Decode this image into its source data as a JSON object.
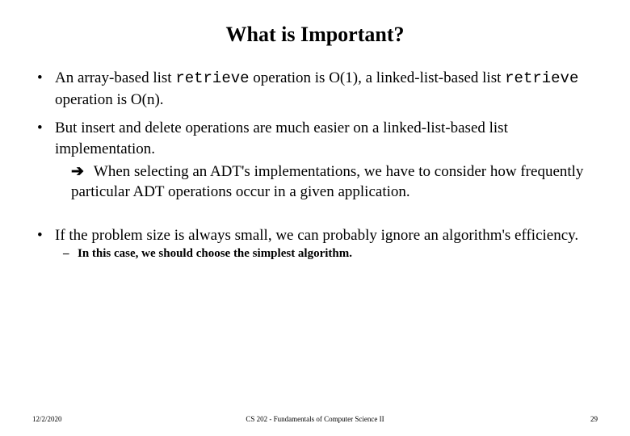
{
  "title": "What is Important?",
  "bullets": {
    "b1_pre": "An array-based list ",
    "b1_code1": "retrieve",
    "b1_mid": " operation is O(1), a linked-list-based list ",
    "b1_code2": "retrieve",
    "b1_post": " operation is O(n).",
    "b2_line1": "But insert and delete operations are much easier on a linked-list-based list implementation.",
    "b2_arrow_text": "When selecting an ADT's implementations, we have to consider how frequently particular ADT operations occur in a given application.",
    "b3": "If the problem size is always small, we can probably ignore an algorithm's efficiency.",
    "b3_sub": "In this case, we should choose the simplest algorithm."
  },
  "footer": {
    "date": "12/2/2020",
    "course": "CS 202 - Fundamentals of Computer Science II",
    "page": "29"
  }
}
